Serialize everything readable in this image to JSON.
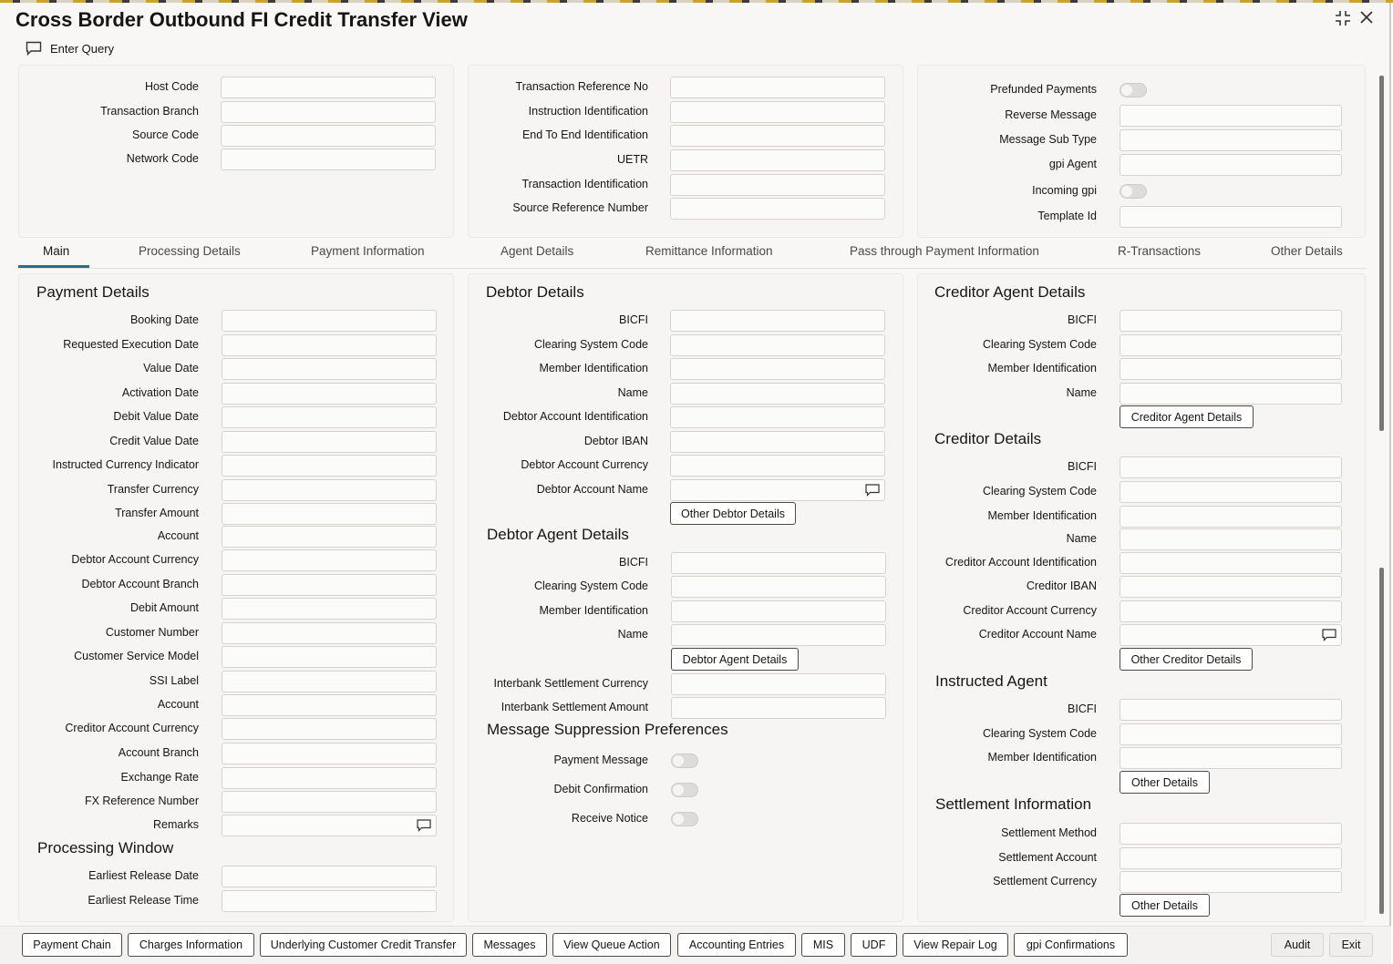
{
  "window": {
    "title": "Cross Border Outbound FI Credit Transfer View"
  },
  "toolbar": {
    "enter_query": "Enter Query"
  },
  "header": {
    "col1": [
      "Host Code",
      "Transaction Branch",
      "Source Code",
      "Network Code"
    ],
    "col2": [
      "Transaction Reference No",
      "Instruction Identification",
      "End To End Identification",
      "UETR",
      "Transaction Identification",
      "Source Reference Number"
    ],
    "col3": {
      "prefunded": "Prefunded Payments",
      "reverse_message": "Reverse Message",
      "message_sub_type": "Message Sub Type",
      "gpi_agent": "gpi Agent",
      "incoming_gpi": "Incoming gpi",
      "template_id": "Template Id"
    }
  },
  "tabs": [
    "Main",
    "Processing Details",
    "Payment Information",
    "Agent Details",
    "Remittance Information",
    "Pass through Payment Information",
    "R-Transactions",
    "Other Details"
  ],
  "payment_details": {
    "title": "Payment Details",
    "fields": [
      "Booking Date",
      "Requested Execution Date",
      "Value Date",
      "Activation Date",
      "Debit Value Date",
      "Credit Value Date",
      "Instructed Currency Indicator",
      "Transfer Currency",
      "Transfer Amount",
      "Account",
      "Debtor Account Currency",
      "Debtor Account Branch",
      "Debit Amount",
      "Customer Number",
      "Customer Service Model",
      "SSI Label",
      "Account",
      "Creditor Account Currency",
      "Account Branch",
      "Exchange Rate",
      "FX Reference Number",
      "Remarks"
    ]
  },
  "processing_window": {
    "title": "Processing Window",
    "fields": [
      "Earliest Release Date",
      "Earliest Release Time"
    ]
  },
  "debtor_details": {
    "title": "Debtor Details",
    "fields": [
      "BICFI",
      "Clearing System Code",
      "Member Identification",
      "Name",
      "Debtor Account Identification",
      "Debtor IBAN",
      "Debtor Account Currency",
      "Debtor Account Name"
    ],
    "button": "Other Debtor Details"
  },
  "debtor_agent_details": {
    "title": "Debtor Agent Details",
    "fields": [
      "BICFI",
      "Clearing System Code",
      "Member Identification",
      "Name"
    ],
    "button": "Debtor Agent Details",
    "extra_fields": [
      "Interbank Settlement Currency",
      "Interbank Settlement Amount"
    ]
  },
  "message_suppression": {
    "title": "Message Suppression Preferences",
    "toggles": [
      "Payment Message",
      "Debit Confirmation",
      "Receive Notice"
    ]
  },
  "creditor_agent_details": {
    "title": "Creditor Agent Details",
    "fields": [
      "BICFI",
      "Clearing System Code",
      "Member Identification",
      "Name"
    ],
    "button": "Creditor Agent Details"
  },
  "creditor_details": {
    "title": "Creditor Details",
    "fields": [
      "BICFI",
      "Clearing System Code",
      "Member Identification",
      "Name",
      "Creditor Account Identification",
      "Creditor IBAN",
      "Creditor Account Currency",
      "Creditor Account Name"
    ],
    "button": "Other Creditor Details"
  },
  "instructed_agent": {
    "title": "Instructed Agent",
    "fields": [
      "BICFI",
      "Clearing System Code",
      "Member Identification"
    ],
    "button": "Other Details"
  },
  "settlement_information": {
    "title": "Settlement Information",
    "fields": [
      "Settlement Method",
      "Settlement Account",
      "Settlement Currency"
    ],
    "button": "Other Details"
  },
  "footer": {
    "buttons": [
      "Payment Chain",
      "Charges Information",
      "Underlying Customer Credit Transfer",
      "Messages",
      "View Queue Action",
      "Accounting Entries",
      "MIS",
      "UDF",
      "View Repair Log",
      "gpi Confirmations"
    ],
    "audit": "Audit",
    "exit": "Exit"
  }
}
